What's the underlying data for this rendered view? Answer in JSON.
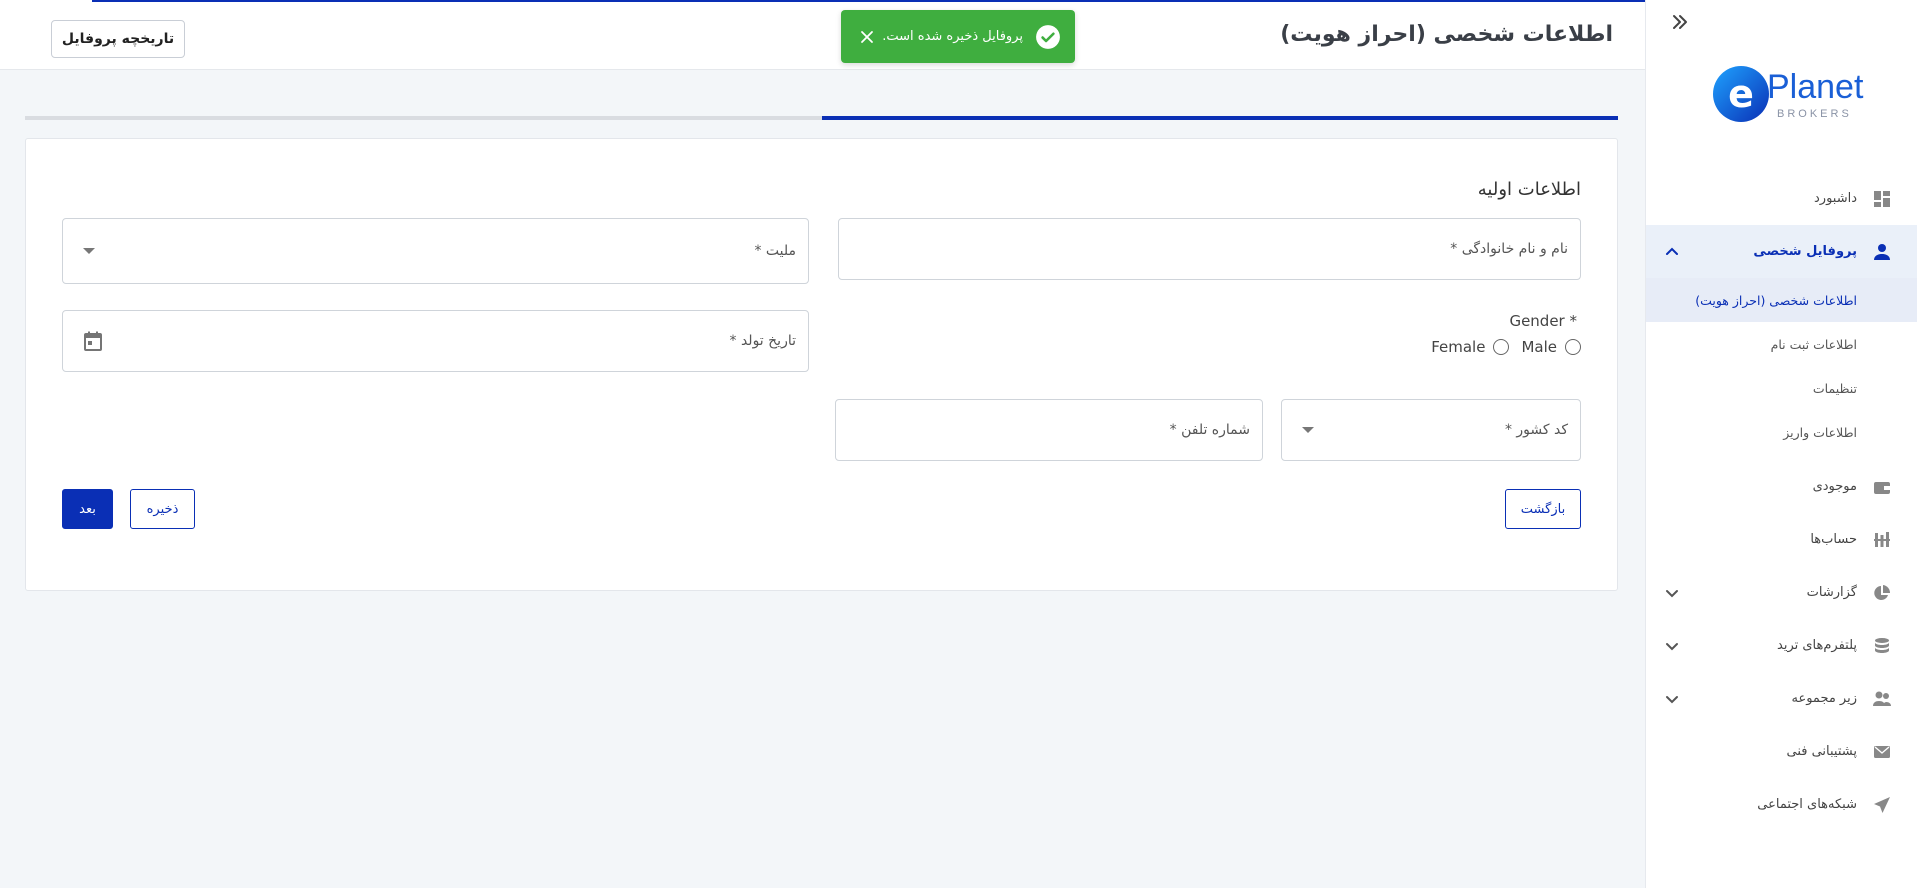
{
  "header": {
    "title": "اطلاعات شخصی (احراز هویت)",
    "history_button": "تاریخچه پروفایل"
  },
  "toast": {
    "message": "پروفایل ذخیره شده است.",
    "color": "#3fae3f"
  },
  "progress": {
    "percent": 50
  },
  "brand": {
    "name": "Planet",
    "sub": "BROKERS",
    "accent": "#0a2fb5"
  },
  "sidebar": {
    "items": [
      {
        "label": "داشبورد",
        "icon": "dashboard-icon"
      },
      {
        "label": "پروفایل شخصی",
        "icon": "user-icon",
        "active": true,
        "expanded": true,
        "children": [
          {
            "label": "اطلاعات شخصی (احراز هویت)",
            "active": true
          },
          {
            "label": "اطلاعات ثبت نام"
          },
          {
            "label": "تنظیمات"
          },
          {
            "label": "اطلاعات واریز"
          }
        ]
      },
      {
        "label": "موجودی",
        "icon": "wallet-icon"
      },
      {
        "label": "حساب‌ها",
        "icon": "accounts-icon"
      },
      {
        "label": "گزارشات",
        "icon": "pie-chart-icon",
        "has_children": true
      },
      {
        "label": "پلتفرم‌های ترید",
        "icon": "database-icon",
        "has_children": true
      },
      {
        "label": "زیر مجموعه",
        "icon": "users-icon",
        "has_children": true
      },
      {
        "label": "پشتیبانی فنی",
        "icon": "mail-icon"
      },
      {
        "label": "شبکه‌های اجتماعی",
        "icon": "send-icon"
      }
    ]
  },
  "form": {
    "section_title": "اطلاعات اولیه",
    "full_name_label": "نام و نام خانوادگی *",
    "nationality_label": "ملیت *",
    "gender_label": "Gender *",
    "gender_options": [
      "Male",
      "Female"
    ],
    "birth_date_label": "تاریخ تولد *",
    "country_code_label": "کد کشور *",
    "phone_label": "شماره تلفن *",
    "back_button": "بازگشت",
    "save_button": "ذخیره",
    "next_button": "بعد"
  }
}
